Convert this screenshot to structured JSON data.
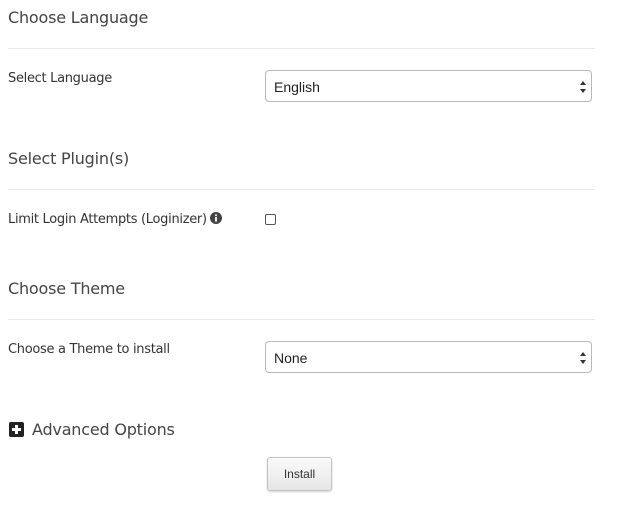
{
  "language_section": {
    "title": "Choose Language",
    "label": "Select Language",
    "selected": "English"
  },
  "plugin_section": {
    "title": "Select Plugin(s)",
    "plugin_label": "Limit Login Attempts (Loginizer)",
    "plugin_checked": false,
    "info_icon": "info-circle-icon"
  },
  "theme_section": {
    "title": "Choose Theme",
    "label": "Choose a Theme to install",
    "selected": "None"
  },
  "advanced": {
    "label": "Advanced Options",
    "icon": "plus-square-icon"
  },
  "install_button": {
    "label": "Install"
  }
}
